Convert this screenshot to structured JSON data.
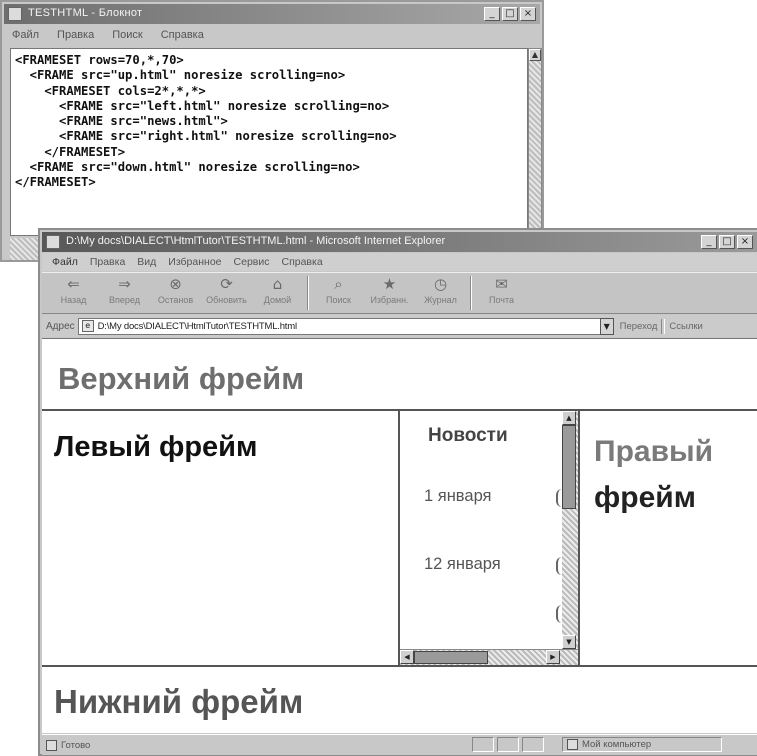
{
  "notepad": {
    "title": "TESTHTML - Блокнот",
    "menu": [
      "Файл",
      "Правка",
      "Поиск",
      "Справка"
    ],
    "code_lines": [
      "<FRAMESET rows=70,*,70>",
      "  <FRAME src=\"up.html\" noresize scrolling=no>",
      "    <FRAMESET cols=2*,*,*>",
      "      <FRAME src=\"left.html\" noresize scrolling=no>",
      "      <FRAME src=\"news.html\">",
      "      <FRAME src=\"right.html\" noresize scrolling=no>",
      "    </FRAMESET>",
      "  <FRAME src=\"down.html\" noresize scrolling=no>",
      "</FRAMESET>"
    ],
    "window_buttons": [
      "_",
      "□",
      "×"
    ]
  },
  "ie": {
    "title": "D:\\My docs\\DIALECT\\HtmlTutor\\TESTHTML.html - Microsoft Internet Explorer",
    "menu": [
      "Файл",
      "Правка",
      "Вид",
      "Избранное",
      "Сервис",
      "Справка"
    ],
    "toolbar": [
      {
        "label": "Назад",
        "icon": "back-arrow-icon",
        "glyph": "⇐"
      },
      {
        "label": "Вперед",
        "icon": "forward-arrow-icon",
        "glyph": "⇒"
      },
      {
        "label": "Останов",
        "icon": "stop-icon",
        "glyph": "⊗"
      },
      {
        "label": "Обновить",
        "icon": "refresh-icon",
        "glyph": "⟳"
      },
      {
        "label": "Домой",
        "icon": "home-icon",
        "glyph": "⌂"
      },
      {
        "label": "Поиск",
        "icon": "search-icon",
        "glyph": "⌕"
      },
      {
        "label": "Избранн.",
        "icon": "favorites-icon",
        "glyph": "★"
      },
      {
        "label": "Журнал",
        "icon": "history-icon",
        "glyph": "◷"
      },
      {
        "label": "Почта",
        "icon": "mail-icon",
        "glyph": "✉"
      }
    ],
    "address": {
      "label": "Адрес",
      "value": "D:\\My docs\\DIALECT\\HtmlTutor\\TESTHTML.html",
      "go_label": "Переход",
      "links_label": "Ссылки"
    },
    "frames": {
      "top": "Верхний фрейм",
      "left": "Левый фрейм",
      "news": {
        "title": "Новости",
        "items": [
          "1 января",
          "12 января"
        ]
      },
      "right": [
        "Правый",
        "фрейм"
      ],
      "bottom": "Нижний фрейм"
    },
    "status": {
      "text": "Готово",
      "zone": "Мой компьютер"
    },
    "window_buttons": [
      "_",
      "□",
      "×"
    ]
  }
}
